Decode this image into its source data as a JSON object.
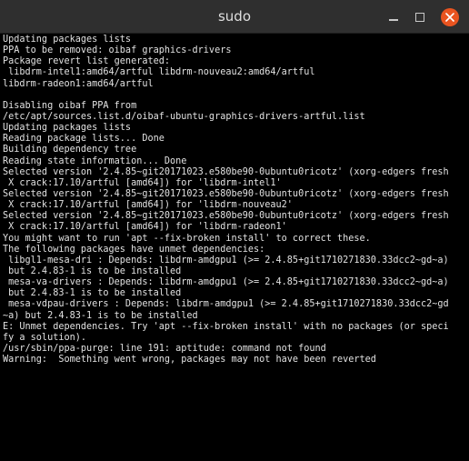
{
  "window": {
    "title": "sudo"
  },
  "terminal": {
    "lines": [
      "Updating packages lists",
      "PPA to be removed: oibaf graphics-drivers",
      "Package revert list generated:",
      " libdrm-intel1:amd64/artful libdrm-nouveau2:amd64/artful",
      "libdrm-radeon1:amd64/artful",
      "",
      "Disabling oibaf PPA from",
      "/etc/apt/sources.list.d/oibaf-ubuntu-graphics-drivers-artful.list",
      "Updating packages lists",
      "Reading package lists... Done",
      "Building dependency tree",
      "Reading state information... Done",
      "Selected version '2.4.85~git20171023.e580be90-0ubuntu0ricotz' (xorg-edgers fresh",
      " X crack:17.10/artful [amd64]) for 'libdrm-intel1'",
      "Selected version '2.4.85~git20171023.e580be90-0ubuntu0ricotz' (xorg-edgers fresh",
      " X crack:17.10/artful [amd64]) for 'libdrm-nouveau2'",
      "Selected version '2.4.85~git20171023.e580be90-0ubuntu0ricotz' (xorg-edgers fresh",
      " X crack:17.10/artful [amd64]) for 'libdrm-radeon1'",
      "You might want to run 'apt --fix-broken install' to correct these.",
      "The following packages have unmet dependencies:",
      " libgl1-mesa-dri : Depends: libdrm-amdgpu1 (>= 2.4.85+git1710271830.33dcc2~gd~a)",
      " but 2.4.83-1 is to be installed",
      " mesa-va-drivers : Depends: libdrm-amdgpu1 (>= 2.4.85+git1710271830.33dcc2~gd~a)",
      " but 2.4.83-1 is to be installed",
      " mesa-vdpau-drivers : Depends: libdrm-amdgpu1 (>= 2.4.85+git1710271830.33dcc2~gd",
      "~a) but 2.4.83-1 is to be installed",
      "E: Unmet dependencies. Try 'apt --fix-broken install' with no packages (or speci",
      "fy a solution).",
      "/usr/sbin/ppa-purge: line 191: aptitude: command not found",
      "Warning:  Something went wrong, packages may not have been reverted"
    ]
  },
  "icons": {
    "minimize": "minimize-icon",
    "maximize": "maximize-icon",
    "close": "close-icon"
  },
  "colors": {
    "titlebar": "#2f2f2f",
    "terminal_background": "#000000",
    "terminal_text": "#e2e2e2",
    "close_button": "#e95420"
  }
}
